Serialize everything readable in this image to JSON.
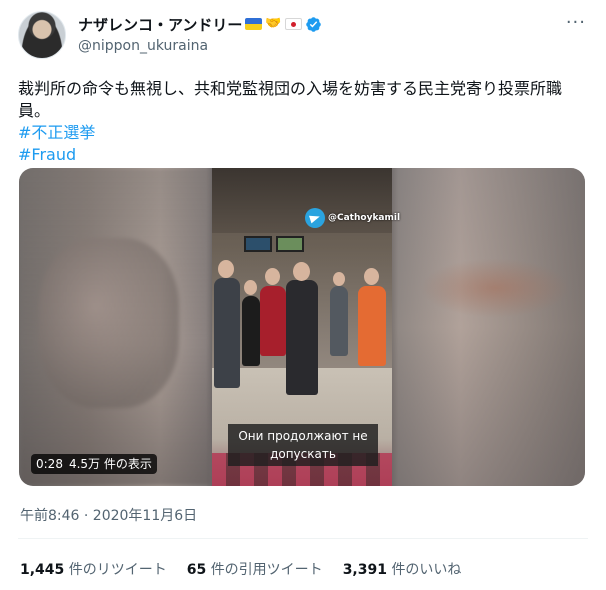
{
  "user": {
    "display_name": "ナザレンコ・アンドリー",
    "handle": "@nippon_ukuraina",
    "emoji_hands": "🤝",
    "verified": true
  },
  "tweet": {
    "text": "裁判所の命令も無視し、共和党監視団の入場を妨害する民主党寄り投票所職員。",
    "hashtags": [
      "#不正選挙",
      "#Fraud"
    ]
  },
  "media": {
    "telegram_label": "@Cathoykamil",
    "caption_line1": "Они продолжают не",
    "caption_line2": "допускать",
    "duration": "0:28",
    "views": "4.5万 件の表示"
  },
  "timestamp": "午前8:46 · 2020年11月6日",
  "stats": {
    "retweets_count": "1,445",
    "retweets_label": "件のリツイート",
    "quotes_count": "65",
    "quotes_label": "件の引用ツイート",
    "likes_count": "3,391",
    "likes_label": "件のいいね"
  },
  "colors": {
    "accent": "#1d9bf0",
    "muted": "#536471",
    "text": "#0f1419"
  },
  "icons": {
    "verified": "verified-badge-icon",
    "more": "more-options-icon",
    "telegram": "telegram-icon"
  }
}
